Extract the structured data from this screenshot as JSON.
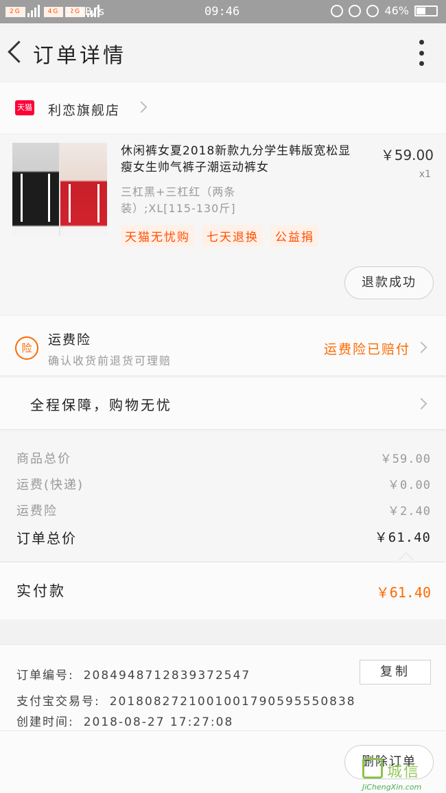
{
  "status_bar": {
    "network_1": "2G",
    "network_2": "4G",
    "network_3": "2G",
    "speed": "3 kB/s",
    "time": "09:46",
    "battery": "46%",
    "battery_level": 0.46
  },
  "header": {
    "title": "订单详情"
  },
  "store": {
    "badge": "天猫",
    "name": "利恋旗舰店"
  },
  "product": {
    "title": "休闲裤女夏2018新款九分学生韩版宽松显瘦女生帅气裤子潮运动裤女",
    "price": "￥59.00",
    "quantity": "x1",
    "sku": "三杠黑+三杠红（两条装）;XL[115-130斤]",
    "tags": [
      "天猫无忧购",
      "七天退换",
      "公益捐"
    ],
    "refund_status": "退款成功"
  },
  "shipping_insurance": {
    "icon_text": "险",
    "title": "运费险",
    "subtitle": "确认收货前退货可理赔",
    "status": "运费险已赔付"
  },
  "guarantee": {
    "label": "全程保障，购物无忧"
  },
  "costs": {
    "rows": [
      {
        "label": "商品总价",
        "value": "￥59.00"
      },
      {
        "label": "运费(快递)",
        "value": "￥0.00"
      },
      {
        "label": "运费险",
        "value": "￥2.40"
      }
    ],
    "total_label": "订单总价",
    "total_value": "￥61.40"
  },
  "payment": {
    "label": "实付款",
    "value": "￥61.40"
  },
  "order_info": {
    "order_no_label": "订单编号:",
    "order_no": "2084948712839372547",
    "alipay_label": "支付宝交易号:",
    "alipay_no": "2018082721001001790595550838",
    "created_label": "创建时间:",
    "created": "2018-08-27 17:27:08",
    "copy_label": "复制"
  },
  "footer": {
    "delete_label": "删除订单"
  },
  "watermark": {
    "cn": "城信",
    "en": "JiChengXin.com"
  },
  "colors": {
    "accent": "#ff6a00",
    "tmall_red": "#ff0036",
    "status_bar": "#9e9e9e"
  }
}
